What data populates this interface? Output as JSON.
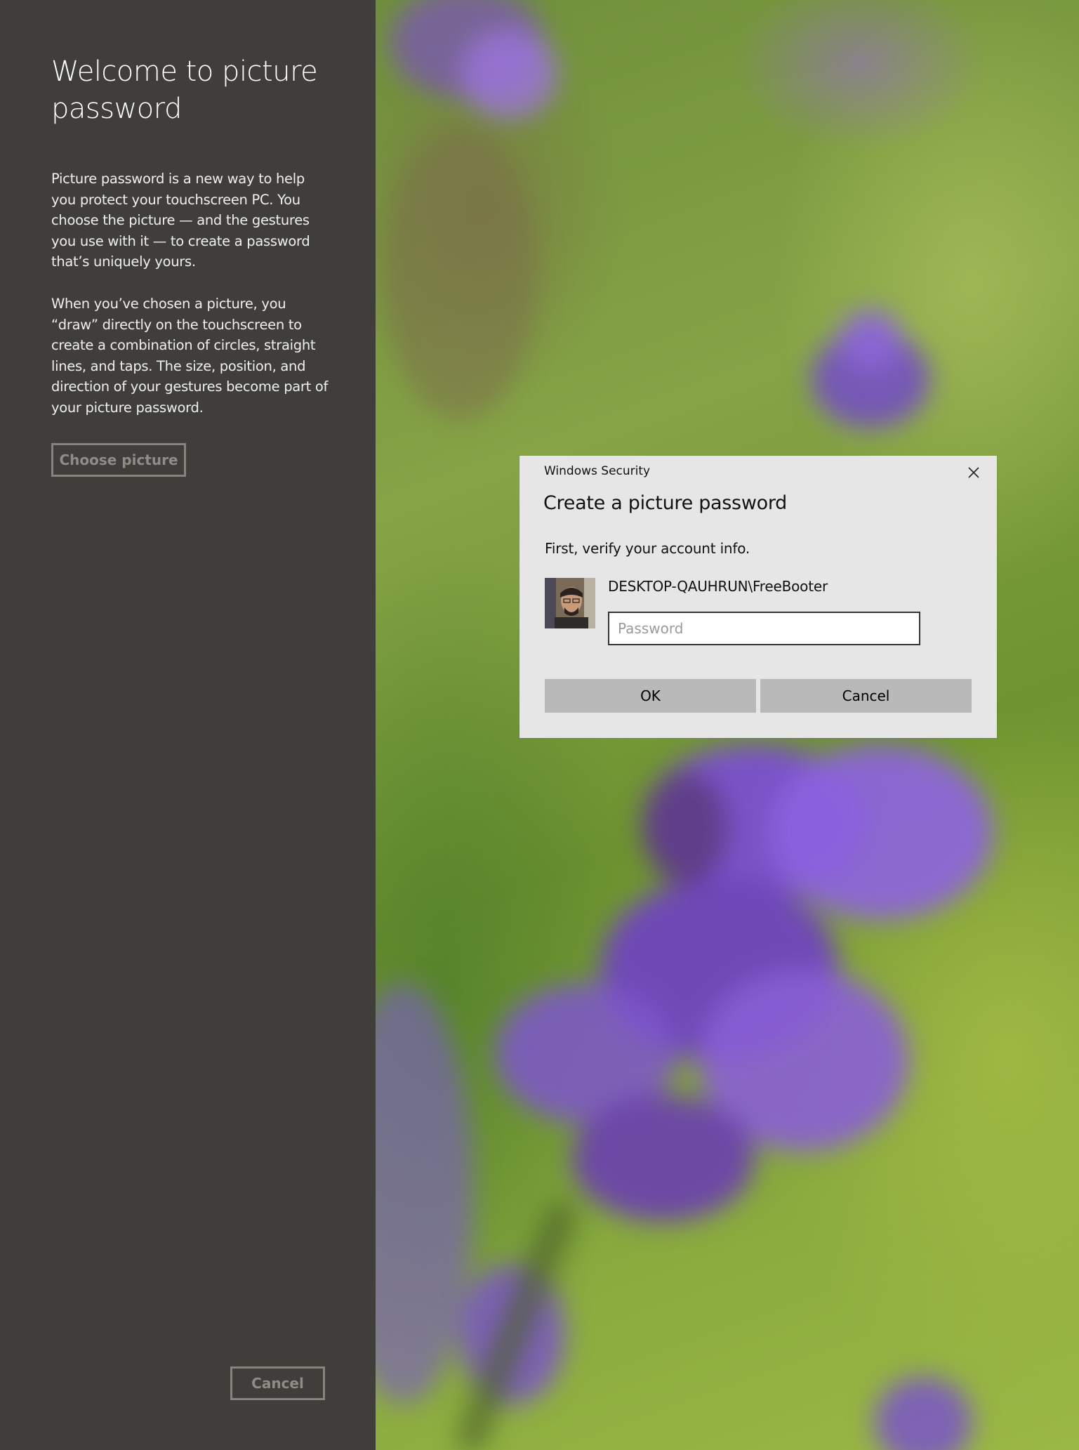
{
  "left_panel": {
    "title": "Welcome to picture password",
    "paragraph_1": "Picture password is a new way to help you protect your touchscreen PC. You choose the picture — and the gestures you use with it — to create a password that’s uniquely yours.",
    "paragraph_2": "When you’ve chosen a picture, you “draw” directly on the touchscreen to create a combination of circles, straight lines, and taps. The size, position, and direction of your gestures become part of your picture password.",
    "choose_picture_label": "Choose picture",
    "cancel_label": "Cancel"
  },
  "dialog": {
    "caption": "Windows Security",
    "heading": "Create a picture password",
    "subtitle": "First, verify your account info.",
    "account_name": "DESKTOP-QAUHRUN\\FreeBooter",
    "password_placeholder": "Password",
    "password_value": "",
    "ok_label": "OK",
    "cancel_label": "Cancel",
    "close_icon": "close-icon"
  },
  "background": {
    "image": "lavander-flowers-photo",
    "colors": {
      "green": "#86a446",
      "purple": "#8a5fd0"
    }
  },
  "colors": {
    "left_panel_bg": "#3f3e3b",
    "dialog_bg": "#e6e6e6",
    "dialog_button_bg": "#b9b9b9",
    "disabled_button_border": "#85847f"
  }
}
